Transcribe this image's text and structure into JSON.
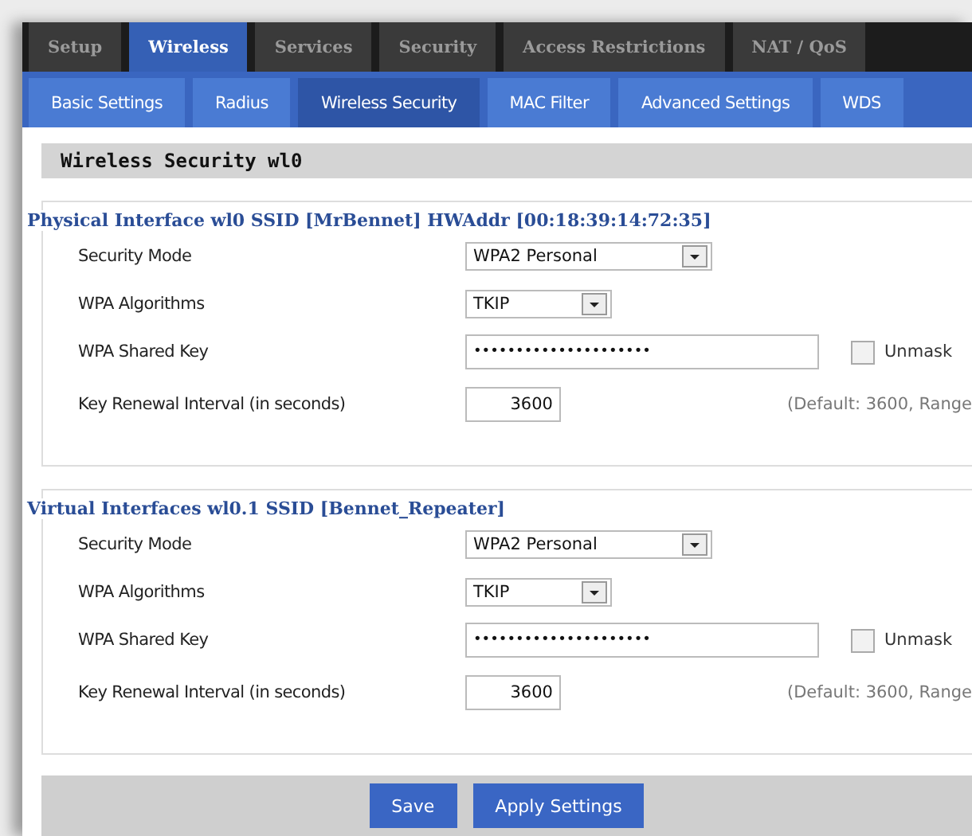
{
  "main_tabs": [
    {
      "label": "Setup",
      "selected": false
    },
    {
      "label": "Wireless",
      "selected": true
    },
    {
      "label": "Services",
      "selected": false
    },
    {
      "label": "Security",
      "selected": false
    },
    {
      "label": "Access Restrictions",
      "selected": false
    },
    {
      "label": "NAT / QoS",
      "selected": false
    }
  ],
  "sub_tabs": [
    {
      "label": "Basic Settings",
      "selected": false
    },
    {
      "label": "Radius",
      "selected": false
    },
    {
      "label": "Wireless Security",
      "selected": true
    },
    {
      "label": "MAC Filter",
      "selected": false
    },
    {
      "label": "Advanced Settings",
      "selected": false
    },
    {
      "label": "WDS",
      "selected": false
    }
  ],
  "section_title": "Wireless Security wl0",
  "interfaces": [
    {
      "legend": "Physical Interface wl0 SSID [MrBennet] HWAddr [00:18:39:14:72:35]",
      "fields": [
        {
          "kind": "select",
          "label": "Security Mode",
          "value": "WPA2 Personal"
        },
        {
          "kind": "select",
          "label": "WPA Algorithms",
          "value": "TKIP"
        },
        {
          "kind": "password",
          "label": "WPA Shared Key",
          "value": "•••••••••••••••••••••",
          "unmask": {
            "label": "Unmask",
            "checked": false
          }
        },
        {
          "kind": "number",
          "label": "Key Renewal Interval (in seconds)",
          "value": "3600",
          "hint": "(Default: 3600, Range"
        }
      ]
    },
    {
      "legend": "Virtual Interfaces wl0.1 SSID [Bennet_Repeater]",
      "fields": [
        {
          "kind": "select",
          "label": "Security Mode",
          "value": "WPA2 Personal"
        },
        {
          "kind": "select",
          "label": "WPA Algorithms",
          "value": "TKIP"
        },
        {
          "kind": "password",
          "label": "WPA Shared Key",
          "value": "•••••••••••••••••••••",
          "unmask": {
            "label": "Unmask",
            "checked": false
          }
        },
        {
          "kind": "number",
          "label": "Key Renewal Interval (in seconds)",
          "value": "3600",
          "hint": "(Default: 3600, Range"
        }
      ]
    }
  ],
  "buttons": [
    "Save",
    "Apply Settings"
  ]
}
